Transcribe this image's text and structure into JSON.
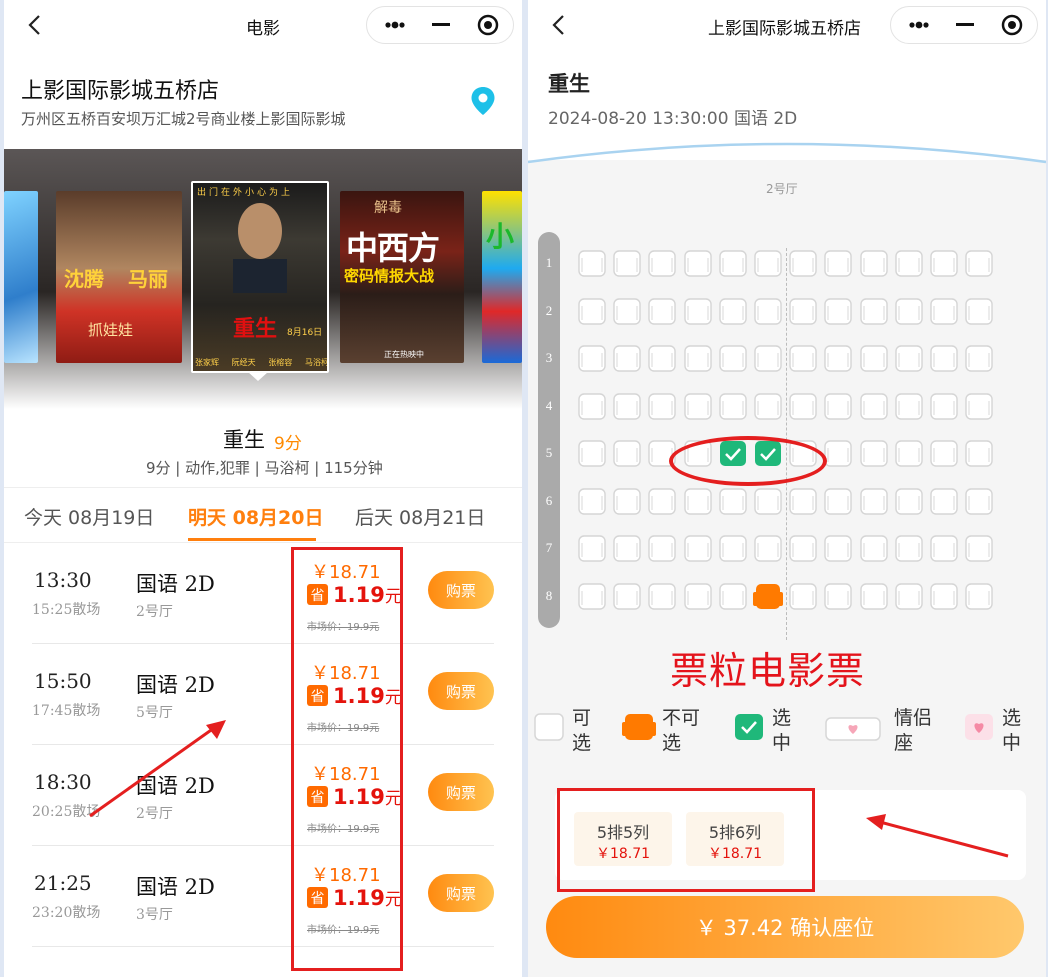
{
  "left": {
    "nav_title": "电影",
    "cinema": {
      "name": "上影国际影城五桥店",
      "address": "万州区五桥百安坝万汇城2号商业楼上影国际影城"
    },
    "movie": {
      "title": "重生",
      "score": "9分",
      "info": "9分 | 动作,犯罪 | 马浴柯 | 115分钟"
    },
    "tabs": [
      "今天 08月19日",
      "明天 08月20日",
      "后天 08月21日"
    ],
    "active_tab": 1,
    "posters": [
      {
        "name": "poster-partial-left",
        "texts": []
      },
      {
        "name": "poster-shen-teng-ma-li",
        "texts": [
          "沈腾",
          "马丽",
          "抓娃娃"
        ]
      },
      {
        "name": "poster-chongsheng",
        "texts": [
          "出门在外小心为上",
          "重生",
          "8月16日",
          "张家辉",
          "阮经天",
          "张榕容",
          "马浴柯"
        ]
      },
      {
        "name": "poster-zhongxifang",
        "texts": [
          "解毒",
          "中西方",
          "密码情报大战",
          "正在热映中"
        ]
      },
      {
        "name": "poster-partial-right",
        "texts": [
          "小"
        ]
      }
    ],
    "showtimes": [
      {
        "time": "13:30",
        "end": "15:25散场",
        "lang": "国语 2D",
        "hall": "2号厅",
        "price": "￥18.71",
        "sheng": "省",
        "discount": "1.19",
        "unit": "元",
        "market": "市场价：19.9元",
        "buy": "购票"
      },
      {
        "time": "15:50",
        "end": "17:45散场",
        "lang": "国语 2D",
        "hall": "5号厅",
        "price": "￥18.71",
        "sheng": "省",
        "discount": "1.19",
        "unit": "元",
        "market": "市场价：19.9元",
        "buy": "购票"
      },
      {
        "time": "18:30",
        "end": "20:25散场",
        "lang": "国语 2D",
        "hall": "2号厅",
        "price": "￥18.71",
        "sheng": "省",
        "discount": "1.19",
        "unit": "元",
        "market": "市场价：19.9元",
        "buy": "购票"
      },
      {
        "time": "21:25",
        "end": "23:20散场",
        "lang": "国语 2D",
        "hall": "3号厅",
        "price": "￥18.71",
        "sheng": "省",
        "discount": "1.19",
        "unit": "元",
        "market": "市场价：19.9元",
        "buy": "购票"
      }
    ]
  },
  "right": {
    "nav_title": "上影国际影城五桥店",
    "movie_title": "重生",
    "session": "2024-08-20 13:30:00 国语 2D",
    "screen_label": "2号厅",
    "row_labels": [
      "1",
      "2",
      "3",
      "4",
      "5",
      "6",
      "7",
      "8"
    ],
    "seats_per_row": 12,
    "selected_seats": [
      [
        5,
        5
      ],
      [
        5,
        6
      ]
    ],
    "unavailable_seats": [
      [
        8,
        6
      ]
    ],
    "watermark": "票粒电影票",
    "legend": [
      {
        "icon": "seat-available-icon",
        "label": "可选"
      },
      {
        "icon": "seat-unavailable-icon",
        "label": "不可选"
      },
      {
        "icon": "seat-selected-icon",
        "label": "选中"
      },
      {
        "icon": "couple-seat-icon",
        "label": "情侣座"
      },
      {
        "icon": "couple-seat-selected-icon",
        "label": "选中"
      }
    ],
    "tickets": [
      {
        "seat": "5排5列",
        "price": "￥18.71"
      },
      {
        "seat": "5排6列",
        "price": "￥18.71"
      }
    ],
    "confirm": "￥ 37.42 确认座位"
  },
  "colors": {
    "accent": "#ff7f0e",
    "selected": "#1fb87a",
    "unavailable": "#ff7a00",
    "annotation": "#e41f1f",
    "discount": "#e4130c"
  }
}
